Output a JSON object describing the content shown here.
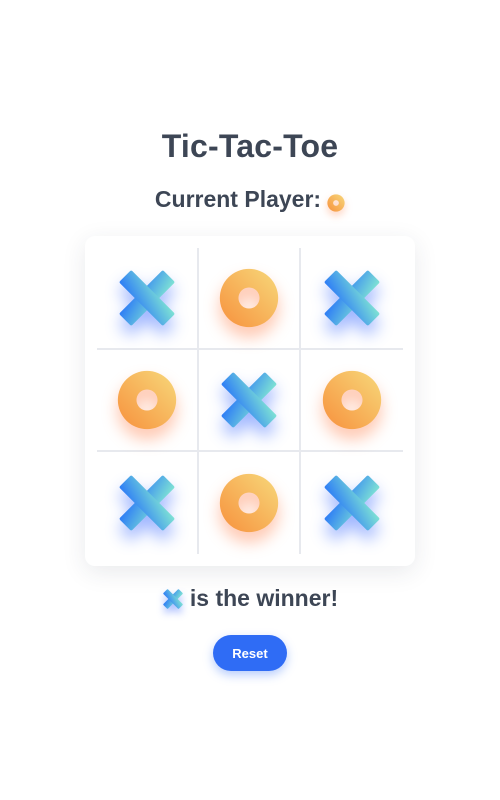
{
  "game": {
    "title": "Tic-Tac-Toe",
    "current_player_label": "Current Player:",
    "current_player": "O",
    "result_text": "is the winner!",
    "winner": "X",
    "reset_label": "Reset",
    "board": [
      [
        "X",
        "O",
        "X"
      ],
      [
        "O",
        "X",
        "O"
      ],
      [
        "X",
        "O",
        "X"
      ]
    ]
  },
  "colors": {
    "x_gradient": [
      "#7fe3d4",
      "#2d7cf6"
    ],
    "o_gradient": [
      "#f7d87a",
      "#f7913d"
    ],
    "button": "#2f6cf5",
    "text": "#3d4655"
  },
  "icons": {
    "x": "x-mark-icon",
    "o": "o-mark-icon"
  }
}
